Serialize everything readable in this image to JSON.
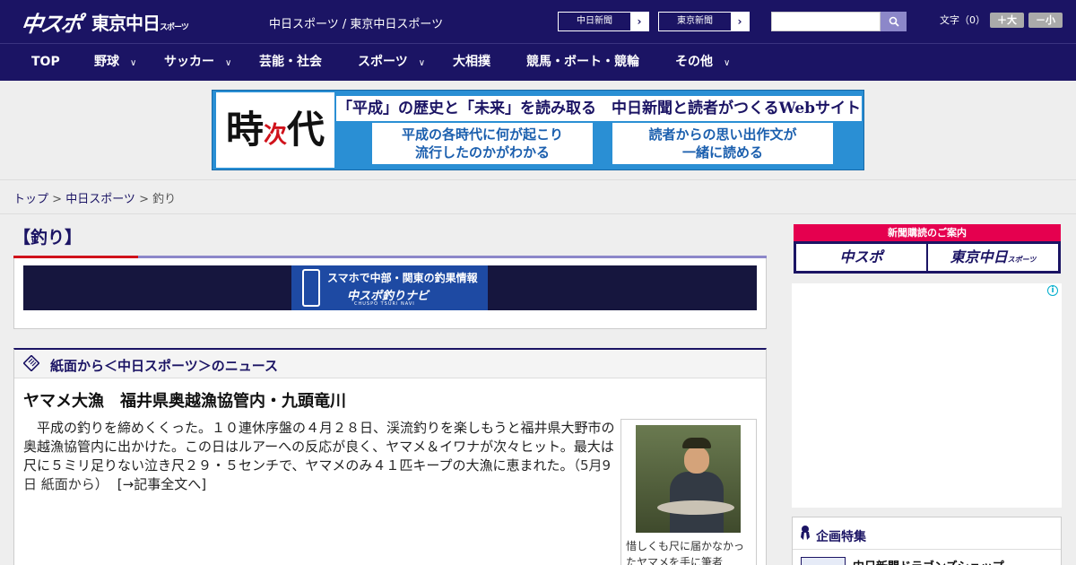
{
  "header": {
    "logo_chuspo": "中スポ",
    "logo_tokyo": "東京中日",
    "logo_tokyo_suffix": "スポーツ",
    "site_names": "中日スポーツ / 東京中日スポーツ",
    "np_buttons": [
      {
        "label": "中日新聞",
        "arrow": "›"
      },
      {
        "label": "東京新聞",
        "arrow": "›"
      }
    ],
    "search_placeholder": "",
    "fontsize_label": "文字（0）",
    "fontsize_plus": "＋大",
    "fontsize_minus": "－小"
  },
  "nav": {
    "items": [
      {
        "label": "TOP",
        "has_menu": false
      },
      {
        "label": "野球",
        "has_menu": true
      },
      {
        "label": "サッカー",
        "has_menu": true
      },
      {
        "label": "芸能・社会",
        "has_menu": false
      },
      {
        "label": "スポーツ",
        "has_menu": true
      },
      {
        "label": "大相撲",
        "has_menu": false
      },
      {
        "label": "競馬・ボート・競輪",
        "has_menu": false
      },
      {
        "label": "その他",
        "has_menu": true
      }
    ],
    "chevron": "∨"
  },
  "banner": {
    "ji_top": "時",
    "ji_mid": "次",
    "ji_end": "代",
    "headline": "「平成」の歴史と「未来」を読み取る　中日新聞と読者がつくるWebサイト",
    "box1_line1": "平成の各時代に何が起こり",
    "box1_line2": "流行したのかがわかる",
    "box2_line1": "読者からの思い出作文が",
    "box2_line2": "一緒に読める"
  },
  "breadcrumb": {
    "top": "トップ",
    "chunichi": "中日スポーツ",
    "current": "釣り",
    "sep": " > "
  },
  "section": {
    "title": "【釣り】"
  },
  "navi_banner": {
    "line1": "スマホで中部・関東の釣果情報",
    "line2": "中スポ釣りナビ",
    "line3": "CHUSPO TSURI NAVI"
  },
  "news": {
    "heading": "紙面から＜中日スポーツ＞のニュース",
    "article_title": "ヤマメ大漁　福井県奥越漁協管内・九頭竜川",
    "article_body": "　平成の釣りを締めくくった。１０連休序盤の４月２８日、渓流釣りを楽しもうと福井県大野市の奥越漁協管内に出かけた。この日はルアーへの反応が良く、ヤマメ＆イワナが次々ヒット。最大は尺に５ミリ足りない泣き尺２９・５センチで、ヤマメのみ４１匹キープの大漁に恵まれた。",
    "article_meta": "（5月9日 紙面から）",
    "read_more": "[→記事全文へ]",
    "photo_caption": "惜しくも尺に届かなかったヤマメを手に筆者"
  },
  "sidebar": {
    "subscribe_label": "新聞購読のご案内",
    "sub1": "中スポ",
    "sub2": "東京中日",
    "sub2_suffix": "スポーツ",
    "ad_info": "i",
    "feature_heading": "企画特集",
    "feature_item": "中日新聞ドラゴンズショップ"
  },
  "colors": {
    "brand_navy": "#1b1464",
    "accent_red": "#d0121b",
    "accent_pink": "#e5004f",
    "accent_lavender": "#8c87c9"
  }
}
